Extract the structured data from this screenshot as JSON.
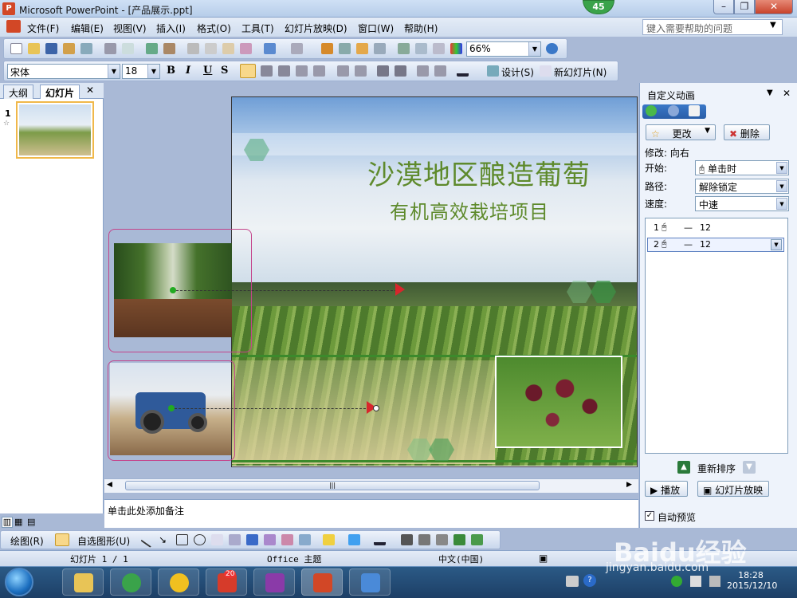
{
  "window": {
    "title": "Microsoft PowerPoint - [产品展示.ppt]",
    "badge": "45"
  },
  "menu": {
    "items": [
      "文件(F)",
      "编辑(E)",
      "视图(V)",
      "插入(I)",
      "格式(O)",
      "工具(T)",
      "幻灯片放映(D)",
      "窗口(W)",
      "帮助(H)"
    ],
    "help_placeholder": "键入需要帮助的问题"
  },
  "toolbar": {
    "zoom": "66%",
    "font": "宋体",
    "size": "18",
    "bold": "B",
    "italic": "I",
    "underline": "U",
    "shadow": "S",
    "design": "设计(S)",
    "new_slide": "新幻灯片(N)"
  },
  "left_pane": {
    "tab_outline": "大纲",
    "tab_slides": "幻灯片",
    "slide_number": "1"
  },
  "slide": {
    "title": "沙漠地区酿造葡萄",
    "subtitle": "有机高效栽培项目"
  },
  "notes": {
    "placeholder": "单击此处添加备注"
  },
  "task_pane": {
    "title": "自定义动画",
    "change_btn": "更改",
    "delete_btn": "删除",
    "modify_label": "修改: 向右",
    "start_label": "开始:",
    "start_value": "单击时",
    "path_label": "路径:",
    "path_value": "解除锁定",
    "speed_label": "速度:",
    "speed_value": "中速",
    "items": [
      {
        "num": "1",
        "name": "12"
      },
      {
        "num": "2",
        "name": "12"
      }
    ],
    "reorder_label": "重新排序",
    "play_btn": "播放",
    "slideshow_btn": "幻灯片放映",
    "autopreview_label": "自动预览"
  },
  "drawing": {
    "draw_label": "绘图(R)",
    "autoshapes_label": "自选图形(U)"
  },
  "status": {
    "slide": "幻灯片 1 / 1",
    "theme": "Office 主题",
    "language": "中文(中国)"
  },
  "taskbar": {
    "time": "18:28",
    "date": "2015/12/10",
    "app_badge": "20"
  },
  "watermark": {
    "brand": "Baidu经验",
    "url": "jingyan.baidu.com"
  }
}
